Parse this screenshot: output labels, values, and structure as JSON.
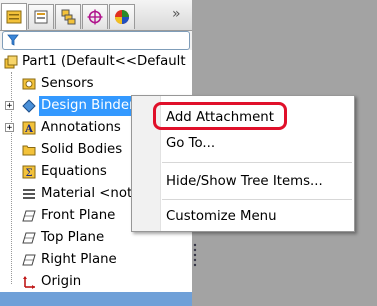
{
  "tabs": [
    {
      "name": "featuremanager-tab",
      "icon": "feature-tree-icon",
      "active": true
    },
    {
      "name": "propertymanager-tab",
      "icon": "property-manager-icon",
      "active": false
    },
    {
      "name": "configurationmanager-tab",
      "icon": "configuration-manager-icon",
      "active": false
    },
    {
      "name": "dimxpert-tab",
      "icon": "dimxpert-icon",
      "active": false
    },
    {
      "name": "display-manager-tab",
      "icon": "appearance-icon",
      "active": false
    }
  ],
  "expand_glyph": "»",
  "tree": {
    "root": "Part1  (Default<<Default",
    "items": [
      {
        "label": "Sensors",
        "icon": "sensor-icon"
      },
      {
        "label": "Design Binder",
        "icon": "design-binder-icon",
        "selected": true,
        "expandable": true
      },
      {
        "label": "Annotations",
        "icon": "annotations-icon",
        "expandable": true
      },
      {
        "label": "Solid Bodies",
        "icon": "folder-icon"
      },
      {
        "label": "Equations",
        "icon": "equations-icon"
      },
      {
        "label": "Material <not specified>",
        "icon": "material-icon"
      },
      {
        "label": "Front Plane",
        "icon": "plane-icon"
      },
      {
        "label": "Top Plane",
        "icon": "plane-icon"
      },
      {
        "label": "Right Plane",
        "icon": "plane-icon"
      },
      {
        "label": "Origin",
        "icon": "origin-icon"
      }
    ]
  },
  "context_menu": {
    "items": [
      "Add Attachment",
      "Go To...",
      "Hide/Show Tree Items...",
      "Customize Menu"
    ]
  },
  "colors": {
    "selection": "#3399ff",
    "highlight_ring": "#e0102a"
  }
}
